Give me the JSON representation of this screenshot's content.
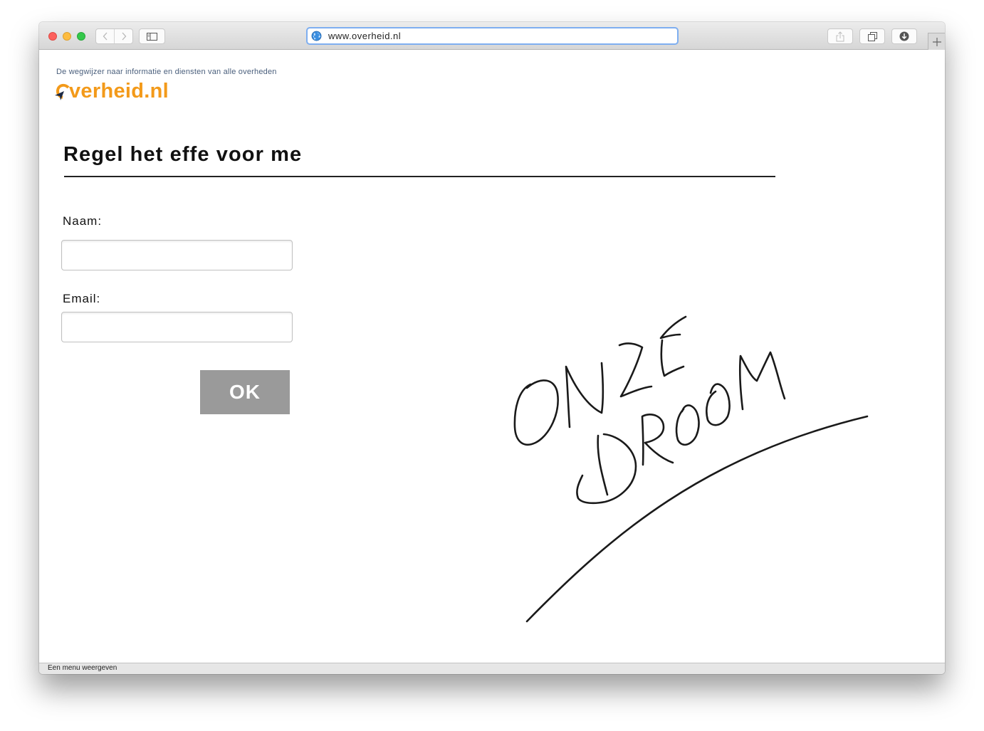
{
  "browser": {
    "url": "www.overheid.nl",
    "status_text": "Een menu weergeven"
  },
  "site": {
    "tagline": "De wegwijzer naar informatie en diensten van alle overheden",
    "logo_text": "overheid.nl",
    "brand_color": "#f39a1a"
  },
  "form": {
    "title": "Regel het effe voor me",
    "name_label": "Naam:",
    "name_value": "",
    "email_label": "Email:",
    "email_value": "",
    "submit_label": "OK"
  },
  "annotation": {
    "handwritten_text": "ONZE DROOM"
  },
  "icons": [
    "back-arrow-icon",
    "forward-arrow-icon",
    "sidebar-icon",
    "globe-icon",
    "share-icon",
    "tabs-icon",
    "download-icon",
    "plus-icon",
    "logo-arrow-icon"
  ]
}
